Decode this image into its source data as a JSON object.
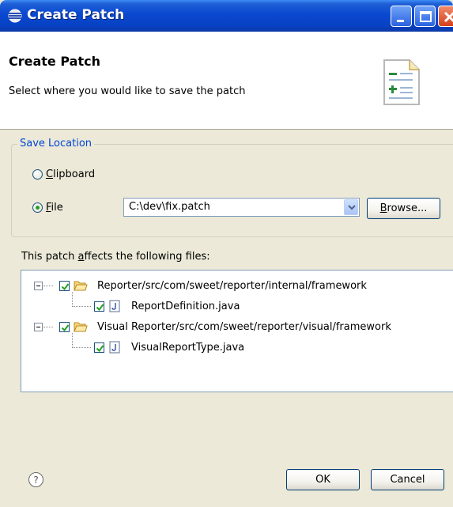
{
  "window": {
    "title": "Create Patch"
  },
  "header": {
    "title": "Create Patch",
    "description": "Select where you would like to save the patch",
    "image_icon": "patch-file-icon"
  },
  "save_location": {
    "legend": "Save Location",
    "clipboard_label_underlined": "C",
    "clipboard_label_rest": "lipboard",
    "file_label_underlined": "F",
    "file_label_rest": "ile",
    "selected": "File",
    "file_path": "C:\\dev\\fix.patch",
    "browse_label_underlined": "B",
    "browse_label_rest": "rowse..."
  },
  "files": {
    "label_pre": "This patch ",
    "label_underlined": "a",
    "label_post": "ffects the following files:",
    "tree": [
      {
        "folder": "Reporter/src/com/sweet/reporter/internal/framework",
        "checked": true,
        "children": [
          {
            "file": "ReportDefinition.java",
            "checked": true
          }
        ]
      },
      {
        "folder": "Visual Reporter/src/com/sweet/reporter/visual/framework",
        "checked": true,
        "children": [
          {
            "file": "VisualReportType.java",
            "checked": true
          }
        ]
      }
    ]
  },
  "footer": {
    "help_icon": "help-icon",
    "ok_label": "OK",
    "cancel_label": "Cancel"
  },
  "colors": {
    "titlebar": "#0a48d0",
    "dialog_bg": "#ece9d8",
    "legend_text": "#0046d5"
  }
}
